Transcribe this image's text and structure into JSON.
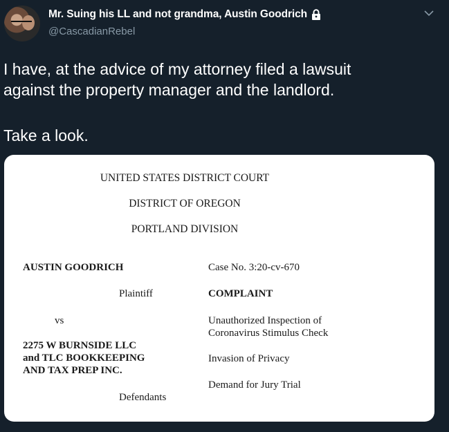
{
  "tweet": {
    "display_name": "Mr. Suing his LL and not grandma, Austin Goodrich",
    "handle": "@CascadianRebel",
    "text_line1": "I have, at the advice of my attorney filed a lawsuit",
    "text_line2": "against the property manager and the landlord.",
    "text_line3": "Take a look."
  },
  "document": {
    "court": "UNITED STATES DISTRICT COURT",
    "district": "DISTRICT OF OREGON",
    "division": "PORTLAND DIVISION",
    "plaintiff_name": "AUSTIN GOODRICH",
    "plaintiff_label": "Plaintiff",
    "vs": "vs",
    "defendant_line1": "2275 W BURNSIDE LLC",
    "defendant_line2": "and TLC BOOKKEEPING",
    "defendant_line3": "AND TAX PREP INC.",
    "defendants_label": "Defendants",
    "case_no": "Case No. 3:20-cv-670",
    "complaint": "COMPLAINT",
    "claim1_line1": "Unauthorized Inspection of",
    "claim1_line2": "Coronavirus Stimulus Check",
    "claim2": "Invasion of Privacy",
    "claim3": "Demand for Jury Trial"
  },
  "icons": {
    "lock": "lock-icon",
    "chevron": "chevron-down-icon"
  },
  "colors": {
    "background": "#15202b",
    "secondary_text": "#8899a6"
  }
}
